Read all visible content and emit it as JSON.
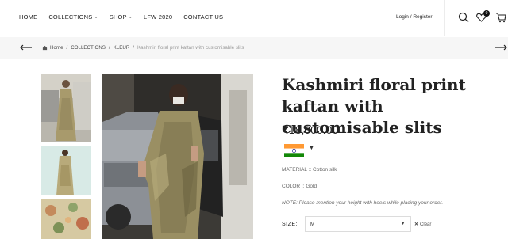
{
  "nav": {
    "home": "HOME",
    "collections": "COLLECTIONS",
    "shop": "SHOP",
    "lfw": "LFW 2020",
    "contact": "CONTACT US"
  },
  "header": {
    "login": "Login / Register",
    "wishlist_count": "0"
  },
  "breadcrumb": {
    "home": "Home",
    "collections": "COLLECTIONS",
    "kleur": "KLEUR",
    "current": "Kashmiri floral print kaftan with customisable slits",
    "separator": "/"
  },
  "product": {
    "title": "Kashmiri floral print kaftan with customisable slits",
    "price": "₹18,000.00",
    "material": "MATERIAL :: Cotton silk",
    "color": "COLOR :: Gold",
    "note": "NOTE: Please mention your height with heels while placing your order.",
    "size_label": "SIZE:",
    "size_value": "M",
    "clear_label": "Clear"
  },
  "colors": {
    "accent": "#222222",
    "breadcrumb_bg": "#f6f6f6",
    "muted_text": "#666666"
  },
  "icons": [
    "search-icon",
    "heart-icon",
    "cart-icon",
    "home-icon",
    "arrow-left-icon",
    "arrow-right-icon",
    "india-flag-icon"
  ]
}
